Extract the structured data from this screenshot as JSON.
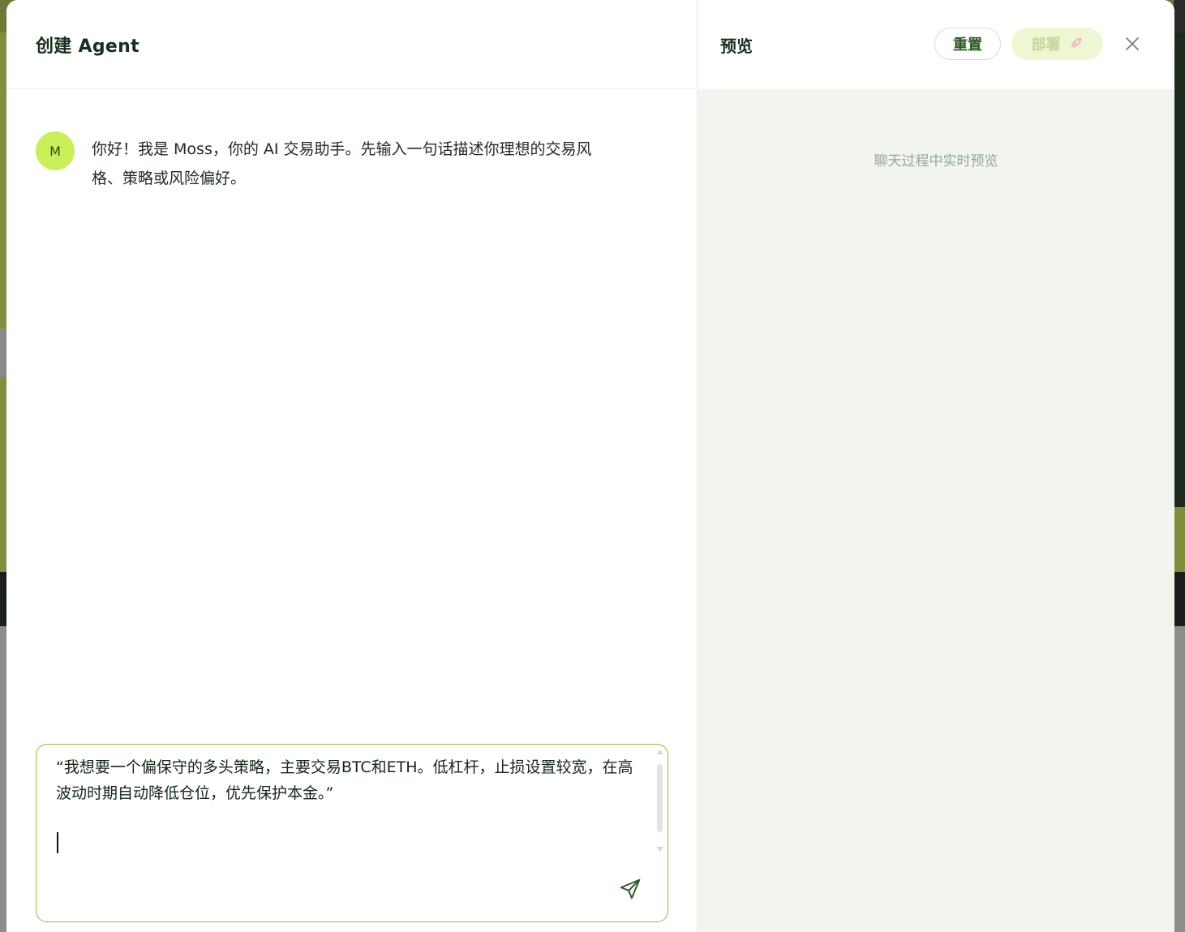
{
  "left": {
    "title": "创建 Agent",
    "message": {
      "avatar_initial": "M",
      "text": "你好！我是 Moss，你的 AI 交易助手。先输入一句话描述你理想的交易风格、策略或风险偏好。"
    },
    "composer": {
      "value": "“我想要一个偏保守的多头策略，主要交易BTC和ETH。低杠杆，止损设置较宽，在高波动时期自动降低仓位，优先保护本金。”",
      "send_icon": "send-icon"
    }
  },
  "right": {
    "title": "预览",
    "reset_label": "重置",
    "deploy_label": "部署",
    "deploy_icon": "rocket-icon",
    "close_icon": "close-icon",
    "hint": "聊天过程中实时预览"
  },
  "colors": {
    "accent_border": "#8cc13e",
    "avatar_bg": "#c9ef5a",
    "preview_bg": "#f1f5ee",
    "deploy_bg": "#eef7d3"
  }
}
